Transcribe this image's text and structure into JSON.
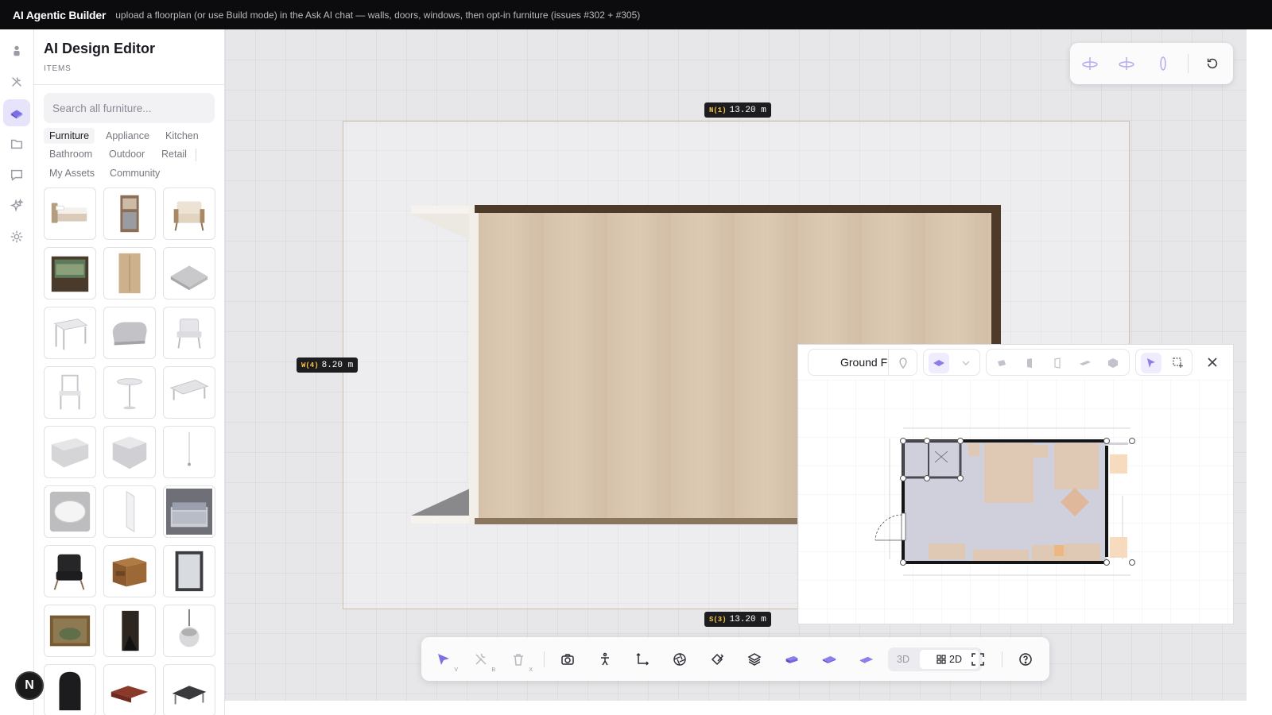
{
  "header": {
    "app_title": "AI Agentic Builder",
    "subtitle": "upload a floorplan (or use Build mode) in the Ask AI chat — walls, doors, windows, then opt-in furniture (issues #302 + #305)"
  },
  "rail": {
    "items": [
      {
        "icon": "logo-icon"
      },
      {
        "icon": "tools-icon"
      },
      {
        "icon": "furniture-icon",
        "active": true
      },
      {
        "icon": "folder-icon"
      },
      {
        "icon": "chat-icon"
      },
      {
        "icon": "sparkles-icon"
      },
      {
        "icon": "settings-icon"
      }
    ],
    "avatar_initial": "N"
  },
  "panel": {
    "title": "AI Design Editor",
    "subtitle": "ITEMS",
    "search_placeholder": "Search all furniture...",
    "categories": [
      "Furniture",
      "Appliance",
      "Kitchen",
      "Bathroom",
      "Outdoor",
      "Retail",
      "My Assets",
      "Community"
    ],
    "active_category": "Furniture"
  },
  "viewport": {
    "dimensions": {
      "north": {
        "key": "N(1)",
        "value": "13.20 m"
      },
      "west": {
        "key": "W(4)",
        "value": "8.20 m"
      },
      "south": {
        "key": "S(3)",
        "value": "13.20 m"
      }
    }
  },
  "minimap": {
    "floor_label": "Ground F"
  },
  "toolbar": {
    "select_key": "V",
    "build_key": "B",
    "delete_key": "X",
    "mode_3d": "3D",
    "mode_2d": "2D",
    "active_mode": "2D"
  },
  "colors": {
    "accent": "#7b6ee6",
    "floor_wood": "#d9c6b0",
    "wall_dark": "#4e3a28"
  }
}
